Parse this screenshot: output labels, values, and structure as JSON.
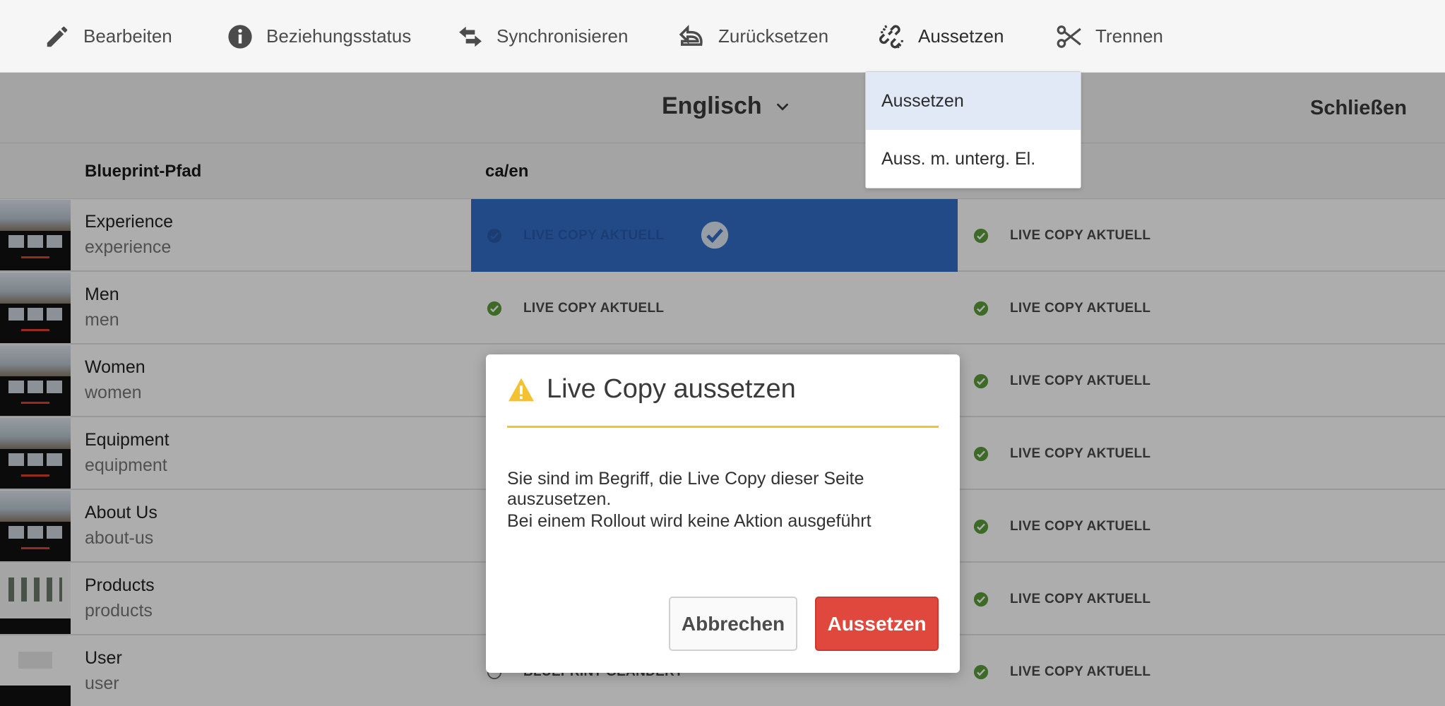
{
  "toolbar": {
    "items": [
      {
        "label": "Bearbeiten",
        "icon": "pencil-icon"
      },
      {
        "label": "Beziehungsstatus",
        "icon": "info-icon"
      },
      {
        "label": "Synchronisieren",
        "icon": "sync-arrows-icon"
      },
      {
        "label": "Zurücksetzen",
        "icon": "undo-icon"
      },
      {
        "label": "Aussetzen",
        "icon": "broken-link-icon"
      },
      {
        "label": "Trennen",
        "icon": "scissors-icon"
      }
    ]
  },
  "dropdown": {
    "items": [
      {
        "label": "Aussetzen",
        "highlighted": true
      },
      {
        "label": "Auss. m. unterg. El."
      }
    ]
  },
  "language": {
    "selected": "Englisch"
  },
  "close_label": "Schließen",
  "table": {
    "columns": [
      "Blueprint-Pfad",
      "ca/en"
    ],
    "rows": [
      {
        "title": "Experience",
        "path": "experience",
        "status1": "LIVE COPY AKTUELL",
        "status2": "LIVE COPY AKTUELL",
        "selected": true
      },
      {
        "title": "Men",
        "path": "men",
        "status1": "LIVE COPY AKTUELL",
        "status2": "LIVE COPY AKTUELL"
      },
      {
        "title": "Women",
        "path": "women",
        "status2": "LIVE COPY AKTUELL"
      },
      {
        "title": "Equipment",
        "path": "equipment",
        "status2": "LIVE COPY AKTUELL"
      },
      {
        "title": "About Us",
        "path": "about-us",
        "status2": "LIVE COPY AKTUELL"
      },
      {
        "title": "Products",
        "path": "products",
        "status2": "LIVE COPY AKTUELL"
      },
      {
        "title": "User",
        "path": "user",
        "status1": "BLUEPRINT GEÄNDERT",
        "status2": "LIVE COPY AKTUELL"
      }
    ]
  },
  "dialog": {
    "title": "Live Copy aussetzen",
    "line1": "Sie sind im Begriff, die Live Copy dieser Seite auszusetzen.",
    "line2": "Bei einem Rollout wird keine Aktion ausgeführt",
    "cancel_label": "Abbrechen",
    "confirm_label": "Aussetzen"
  },
  "colors": {
    "accent_blue": "#326ec8",
    "status_green": "#5a9e3a",
    "warning_yellow": "#f2c230",
    "confirm_red": "#e0483e"
  }
}
